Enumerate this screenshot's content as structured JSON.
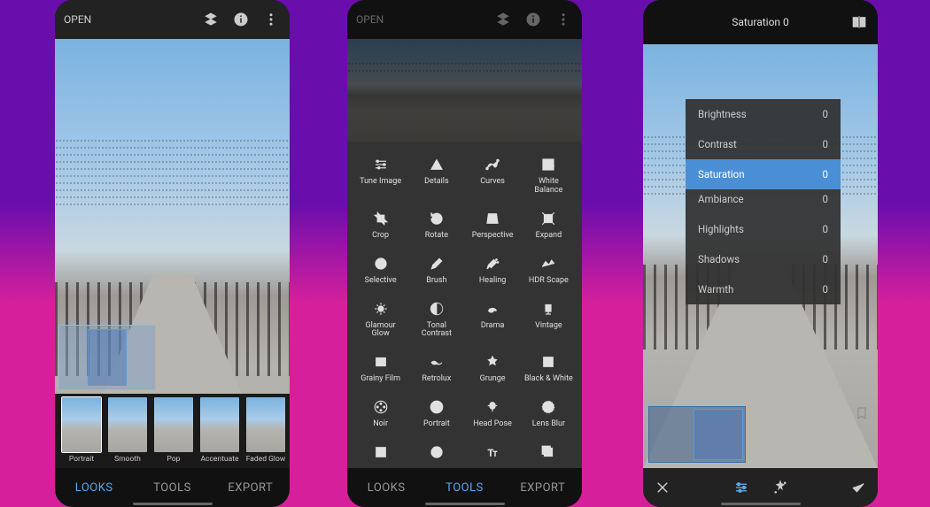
{
  "topbar": {
    "open_label": "OPEN"
  },
  "nav": {
    "looks": "LOOKS",
    "tools": "TOOLS",
    "export": "EXPORT"
  },
  "filters": [
    {
      "label": "Portrait"
    },
    {
      "label": "Smooth"
    },
    {
      "label": "Pop"
    },
    {
      "label": "Accentuate"
    },
    {
      "label": "Faded Glow"
    }
  ],
  "tools": [
    {
      "label": "Tune Image"
    },
    {
      "label": "Details"
    },
    {
      "label": "Curves"
    },
    {
      "label": "White Balance"
    },
    {
      "label": "Crop"
    },
    {
      "label": "Rotate"
    },
    {
      "label": "Perspective"
    },
    {
      "label": "Expand"
    },
    {
      "label": "Selective"
    },
    {
      "label": "Brush"
    },
    {
      "label": "Healing"
    },
    {
      "label": "HDR Scape"
    },
    {
      "label": "Glamour Glow"
    },
    {
      "label": "Tonal Contrast"
    },
    {
      "label": "Drama"
    },
    {
      "label": "Vintage"
    },
    {
      "label": "Grainy Film"
    },
    {
      "label": "Retrolux"
    },
    {
      "label": "Grunge"
    },
    {
      "label": "Black & White"
    },
    {
      "label": "Noir"
    },
    {
      "label": "Portrait"
    },
    {
      "label": "Head Pose"
    },
    {
      "label": "Lens Blur"
    }
  ],
  "adjust": {
    "title_name": "Saturation",
    "title_value": "0",
    "rows": [
      {
        "name": "Brightness",
        "value": "0"
      },
      {
        "name": "Contrast",
        "value": "0"
      },
      {
        "name": "Saturation",
        "value": "0",
        "selected": true
      },
      {
        "name": "Ambiance",
        "value": "0",
        "ambiance": true
      },
      {
        "name": "Highlights",
        "value": "0"
      },
      {
        "name": "Shadows",
        "value": "0"
      },
      {
        "name": "Warmth",
        "value": "0"
      }
    ]
  }
}
